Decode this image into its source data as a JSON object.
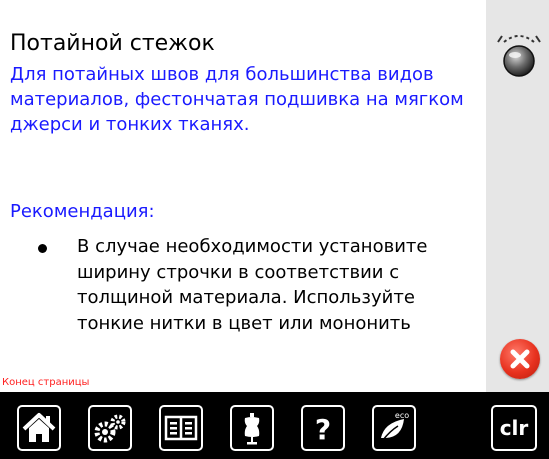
{
  "content": {
    "title": "Потайной стежок",
    "description": "Для потайных швов для большинства видов материалов, фестончатая подшивка на мягком джерси и тонких тканях.",
    "recommendation_heading": "Рекомендация:",
    "recommendation_items": [
      "В случае необходимости установите ширину строчки в соответствии  с  толщиной материала. Используйте тонкие нитки в цвет или мононить"
    ],
    "page_end_label": "Конец страницы"
  },
  "side": {
    "knob_icon": "stitch-width-knob-icon",
    "close_icon": "close-icon"
  },
  "toolbar": {
    "items": [
      {
        "icon": "home-icon"
      },
      {
        "icon": "settings-gears-icon"
      },
      {
        "icon": "tutorial-book-icon"
      },
      {
        "icon": "creative-consultant-dress-form-icon"
      },
      {
        "icon": "help-icon",
        "label": "?"
      },
      {
        "icon": "eco-icon",
        "label": "eco"
      }
    ],
    "clr_label": "clr"
  },
  "colors": {
    "heading_blue": "#1a1aff",
    "page_end_red": "#ff2020",
    "side_panel": "#e6e6e6",
    "toolbar_bg": "#000000",
    "close_red": "#e8321f"
  }
}
